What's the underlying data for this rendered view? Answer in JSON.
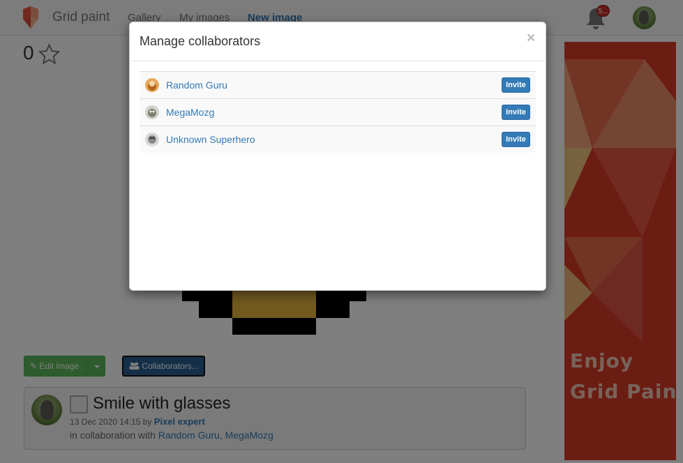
{
  "navbar": {
    "brand": "Grid paint",
    "links": [
      "Gallery",
      "My images",
      "New image"
    ],
    "notification_count": "5..."
  },
  "page": {
    "rating": "0",
    "edit_button": "Edit image",
    "collaborators_button": "Collaborators...",
    "image": {
      "title": "Smile with glasses",
      "date": "13 Dec 2020 14:15",
      "by": "by",
      "author": "Pixel expert",
      "collab_prefix": "in collaboration with",
      "collaborators": "Random Guru, MegaMozg"
    }
  },
  "ad": {
    "line1": "Enjoy",
    "line2": "Grid Paint!"
  },
  "modal": {
    "title": "Manage collaborators",
    "close": "×",
    "users": [
      {
        "name": "Random Guru",
        "action": "Invite"
      },
      {
        "name": "MegaMozg",
        "action": "Invite"
      },
      {
        "name": "Unknown Superhero",
        "action": "Invite"
      }
    ]
  },
  "colors": {
    "primary": "#337ab7",
    "success": "#5cb85c",
    "ad_red": "#d93a26",
    "badge_red": "#c9302c"
  },
  "icons": [
    "grid-paint-logo-icon",
    "bell-icon",
    "star-icon",
    "pencil-icon",
    "users-icon",
    "caret-down-icon",
    "close-icon"
  ]
}
